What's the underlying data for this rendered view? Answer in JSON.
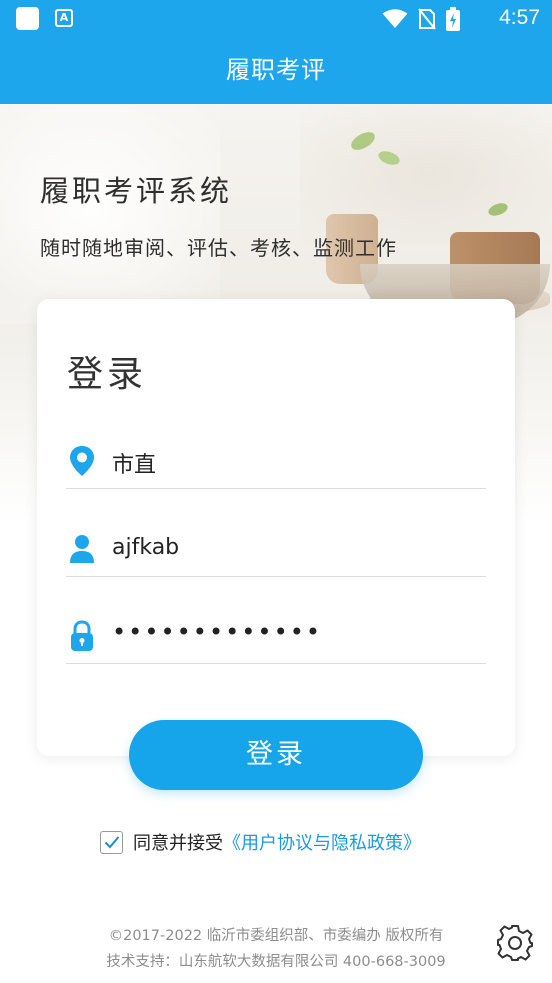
{
  "status_bar": {
    "time": "4:57",
    "icons": [
      "square-icon",
      "app-notification-icon",
      "wifi-icon",
      "no-sim-icon",
      "battery-charging-icon"
    ],
    "app_icon_letter": "A"
  },
  "app_bar": {
    "title": "履职考评"
  },
  "hero": {
    "title": "履职考评系统",
    "subtitle": "随时随地审阅、评估、考核、监测工作"
  },
  "login_card": {
    "title": "登录",
    "fields": [
      {
        "icon": "location-pin-icon",
        "value": "市直"
      },
      {
        "icon": "user-icon",
        "value": "ajfkab"
      },
      {
        "icon": "lock-icon",
        "value": "•••••••••••••"
      }
    ],
    "button_label": "登录"
  },
  "agreement": {
    "checked": true,
    "prefix": "同意并接受",
    "link": "《用户协议与隐私政策》"
  },
  "footer": {
    "copyright": "©2017-2022 临沂市委组织部、市委编办 版权所有",
    "support": "技术支持：山东航软大数据有限公司 400-668-3009"
  },
  "colors": {
    "primary": "#1ea6ec",
    "button": "#16a4ea",
    "link": "#1a9be0"
  }
}
